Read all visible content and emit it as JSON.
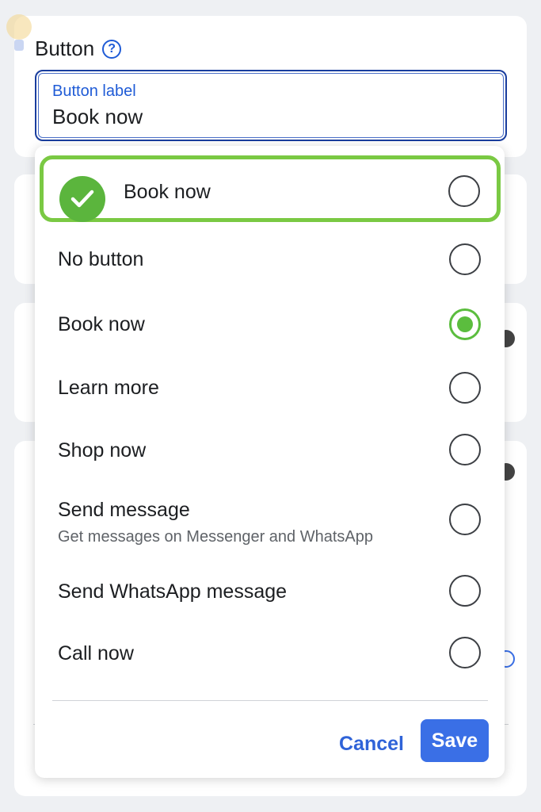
{
  "section": {
    "title": "Button"
  },
  "label_field": {
    "caption": "Button label",
    "value": "Book now"
  },
  "highlighted_option": {
    "label": "Book now"
  },
  "options": [
    {
      "label": "No button",
      "sublabel": "",
      "checked": false
    },
    {
      "label": "Book now",
      "sublabel": "",
      "checked": true
    },
    {
      "label": "Learn more",
      "sublabel": "",
      "checked": false
    },
    {
      "label": "Shop now",
      "sublabel": "",
      "checked": false
    },
    {
      "label": "Send message",
      "sublabel": "Get messages on Messenger and WhatsApp",
      "checked": false
    },
    {
      "label": "Send WhatsApp message",
      "sublabel": "",
      "checked": false
    },
    {
      "label": "Call now",
      "sublabel": "",
      "checked": false
    }
  ],
  "actions": {
    "cancel_label": "Cancel",
    "save_label": "Save"
  },
  "colors": {
    "accent_blue": "#3a6fe6",
    "check_green": "#5bbd3e",
    "highlight_green": "#7ac943"
  },
  "icons": {
    "help": "help-icon",
    "check": "check-icon"
  }
}
